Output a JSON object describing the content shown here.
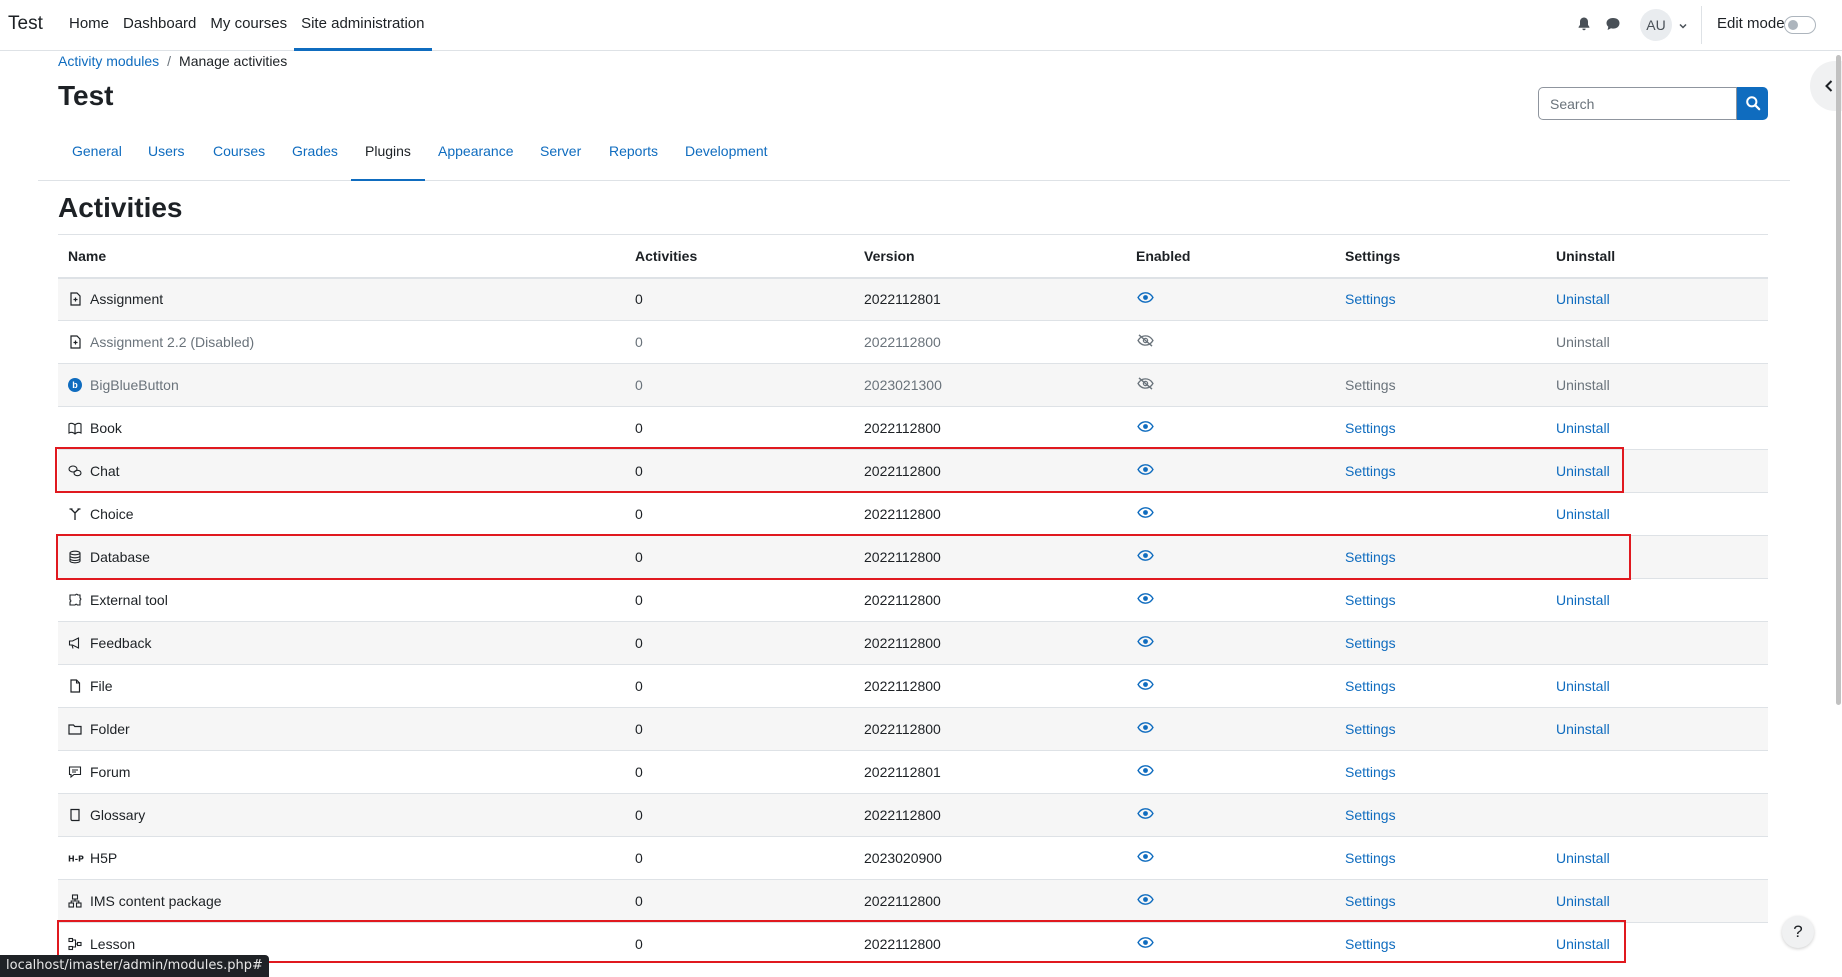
{
  "navbar": {
    "brand": "Test",
    "items": [
      {
        "label": "Home",
        "active": false
      },
      {
        "label": "Dashboard",
        "active": false
      },
      {
        "label": "My courses",
        "active": false
      },
      {
        "label": "Site administration",
        "active": true
      }
    ],
    "avatar_initials": "AU",
    "edit_mode_label": "Edit mode",
    "edit_mode_on": false
  },
  "breadcrumb": {
    "items": [
      {
        "label": "Activity modules",
        "link": true
      },
      {
        "label": "Manage activities",
        "link": false
      }
    ]
  },
  "page": {
    "title": "Test",
    "search_placeholder": "Search"
  },
  "tabs": [
    {
      "label": "General",
      "active": false
    },
    {
      "label": "Users",
      "active": false
    },
    {
      "label": "Courses",
      "active": false
    },
    {
      "label": "Grades",
      "active": false
    },
    {
      "label": "Plugins",
      "active": true
    },
    {
      "label": "Appearance",
      "active": false
    },
    {
      "label": "Server",
      "active": false
    },
    {
      "label": "Reports",
      "active": false
    },
    {
      "label": "Development",
      "active": false
    }
  ],
  "section": {
    "heading": "Activities",
    "columns": [
      "Name",
      "Activities",
      "Version",
      "Enabled",
      "Settings",
      "Uninstall"
    ],
    "rows": [
      {
        "icon": "assignment-icon",
        "name": "Assignment",
        "activities": "0",
        "version": "2022112801",
        "enabled": true,
        "settings": "Settings",
        "uninstall": "Uninstall",
        "disabled": false
      },
      {
        "icon": "assignment-icon",
        "name": "Assignment 2.2 (Disabled)",
        "activities": "0",
        "version": "2022112800",
        "enabled": false,
        "settings": "",
        "uninstall": "Uninstall",
        "disabled": true
      },
      {
        "icon": "bigbluebutton-icon",
        "name": "BigBlueButton",
        "activities": "0",
        "version": "2023021300",
        "enabled": false,
        "settings": "Settings",
        "uninstall": "Uninstall",
        "disabled": true
      },
      {
        "icon": "book-icon",
        "name": "Book",
        "activities": "0",
        "version": "2022112800",
        "enabled": true,
        "settings": "Settings",
        "uninstall": "Uninstall",
        "disabled": false
      },
      {
        "icon": "chat-icon",
        "name": "Chat",
        "activities": "0",
        "version": "2022112800",
        "enabled": true,
        "settings": "Settings",
        "uninstall": "Uninstall",
        "disabled": false
      },
      {
        "icon": "choice-icon",
        "name": "Choice",
        "activities": "0",
        "version": "2022112800",
        "enabled": true,
        "settings": "",
        "uninstall": "Uninstall",
        "disabled": false
      },
      {
        "icon": "database-icon",
        "name": "Database",
        "activities": "0",
        "version": "2022112800",
        "enabled": true,
        "settings": "Settings",
        "uninstall": "",
        "disabled": false
      },
      {
        "icon": "external-tool-icon",
        "name": "External tool",
        "activities": "0",
        "version": "2022112800",
        "enabled": true,
        "settings": "Settings",
        "uninstall": "Uninstall",
        "disabled": false
      },
      {
        "icon": "feedback-icon",
        "name": "Feedback",
        "activities": "0",
        "version": "2022112800",
        "enabled": true,
        "settings": "Settings",
        "uninstall": "",
        "disabled": false
      },
      {
        "icon": "file-icon",
        "name": "File",
        "activities": "0",
        "version": "2022112800",
        "enabled": true,
        "settings": "Settings",
        "uninstall": "Uninstall",
        "disabled": false
      },
      {
        "icon": "folder-icon",
        "name": "Folder",
        "activities": "0",
        "version": "2022112800",
        "enabled": true,
        "settings": "Settings",
        "uninstall": "Uninstall",
        "disabled": false
      },
      {
        "icon": "forum-icon",
        "name": "Forum",
        "activities": "0",
        "version": "2022112801",
        "enabled": true,
        "settings": "Settings",
        "uninstall": "",
        "disabled": false
      },
      {
        "icon": "glossary-icon",
        "name": "Glossary",
        "activities": "0",
        "version": "2022112800",
        "enabled": true,
        "settings": "Settings",
        "uninstall": "",
        "disabled": false
      },
      {
        "icon": "h5p-icon",
        "name": "H5P",
        "activities": "0",
        "version": "2023020900",
        "enabled": true,
        "settings": "Settings",
        "uninstall": "Uninstall",
        "disabled": false
      },
      {
        "icon": "ims-package-icon",
        "name": "IMS content package",
        "activities": "0",
        "version": "2022112800",
        "enabled": true,
        "settings": "Settings",
        "uninstall": "Uninstall",
        "disabled": false
      },
      {
        "icon": "lesson-icon",
        "name": "Lesson",
        "activities": "0",
        "version": "2022112800",
        "enabled": true,
        "settings": "Settings",
        "uninstall": "Uninstall",
        "disabled": false
      }
    ]
  },
  "status_bar": "localhost/imaster/admin/modules.php#",
  "help_label": "?",
  "colors": {
    "link": "#0f6cbf",
    "highlight": "#e0191f",
    "stripe": "#f6f6f6",
    "muted": "#6a737b"
  }
}
